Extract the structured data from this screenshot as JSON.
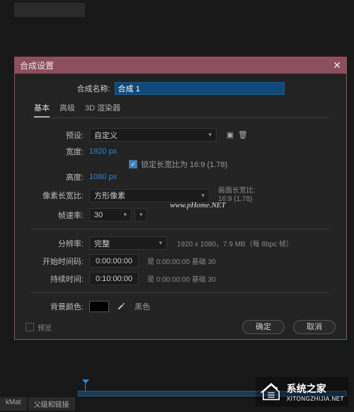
{
  "dialog": {
    "title": "合成设置",
    "name_label": "合成名称:",
    "name_value": "合成 1",
    "tabs": {
      "basic": "基本",
      "advanced": "高级",
      "renderer": "3D 渲染器"
    },
    "preset_label": "预设:",
    "preset_value": "自定义",
    "width_label": "宽度:",
    "width_value": "1920 px",
    "height_label": "高度:",
    "height_value": "1080 px",
    "lock_label": "锁定长宽比为 16:9 (1.78)",
    "par_label": "像素长宽比:",
    "par_value": "方形像素",
    "frame_ar_label": "画面长宽比:",
    "frame_ar_value": "16:9 (1.78)",
    "fps_label": "帧速率:",
    "fps_value": "30",
    "res_label": "分辨率:",
    "res_value": "完整",
    "res_info": "1920 x 1080，7.9 MB（每 8bpc 帧）",
    "start_label": "开始时间码:",
    "start_value": "0:00:00:00",
    "start_base": "是 0:00:00:00  基础 30",
    "dur_label": "持续时间:",
    "dur_value": "0:10:00:00",
    "dur_base": "是 0:00:00:00  基础 30",
    "bg_label": "背景颜色:",
    "bg_name": "黑色",
    "preview": "预览",
    "ok": "确定",
    "cancel": "取消"
  },
  "watermark": "www.pHome.NET",
  "bottom": {
    "tab1": "kMat",
    "tab2": "父级和链接"
  },
  "brand": {
    "name": "系统之家",
    "url": "XITONGZHIJIA.NET"
  }
}
